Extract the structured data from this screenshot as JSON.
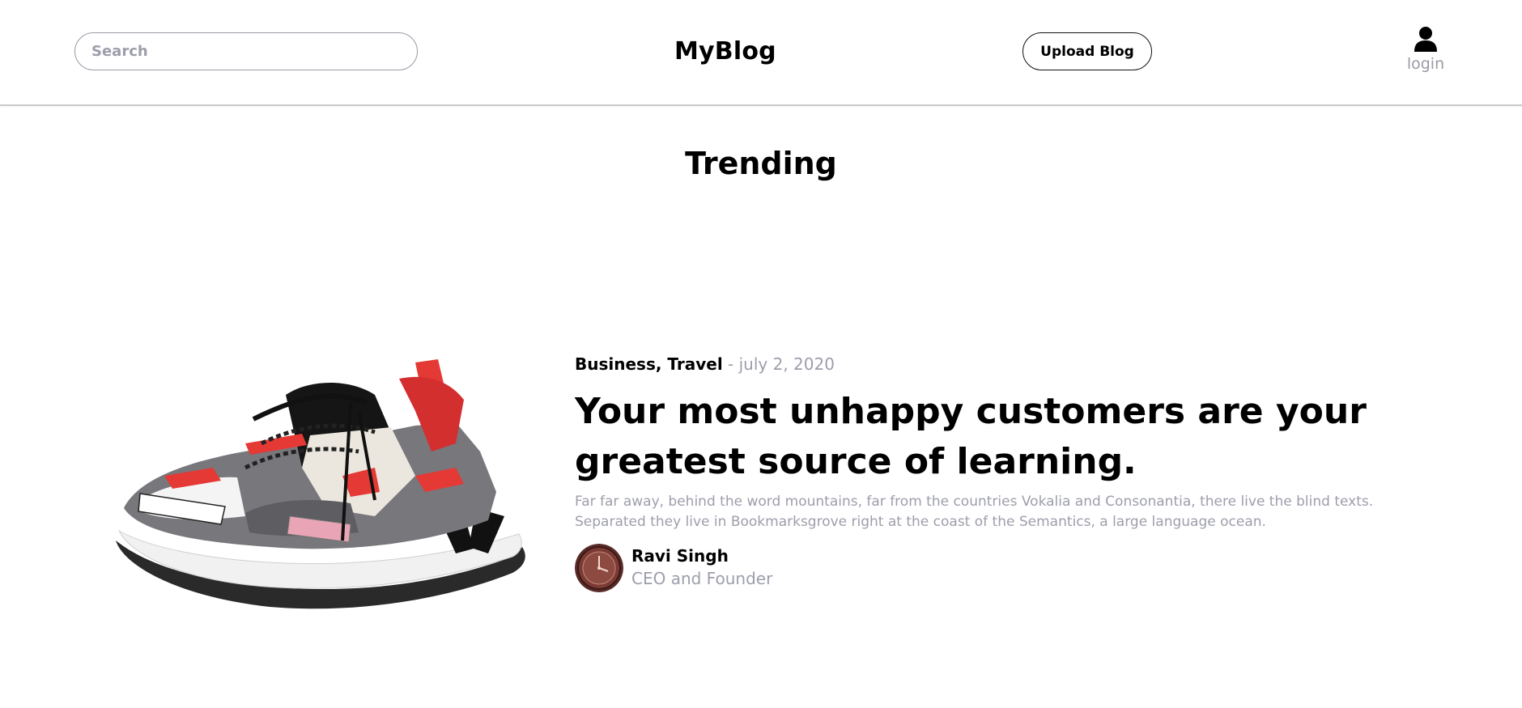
{
  "header": {
    "search": {
      "placeholder": "Search",
      "value": ""
    },
    "brand": "MyBlog",
    "upload_label": "Upload Blog",
    "login_label": "login",
    "login_icon": "user-icon"
  },
  "trending": {
    "title": "Trending"
  },
  "article": {
    "categories": "Business, Travel",
    "separator": "-",
    "date": "july 2, 2020",
    "title": "Your most unhappy customers are your greatest source of learning.",
    "excerpt": "Far far away, behind the word mountains, far from the countries Vokalia and Consonantia, there live the blind texts. Separated they live in Bookmarksgrove right at the coast of the Semantics, a large language ocean.",
    "image": "sneaker-photo",
    "author": {
      "name": "Ravi Singh",
      "role": "CEO and Founder",
      "avatar": "watch-photo"
    }
  },
  "colors": {
    "muted_text": "#9d9eab",
    "border": "#9a9aa5",
    "text": "#000000",
    "background": "#ffffff"
  }
}
